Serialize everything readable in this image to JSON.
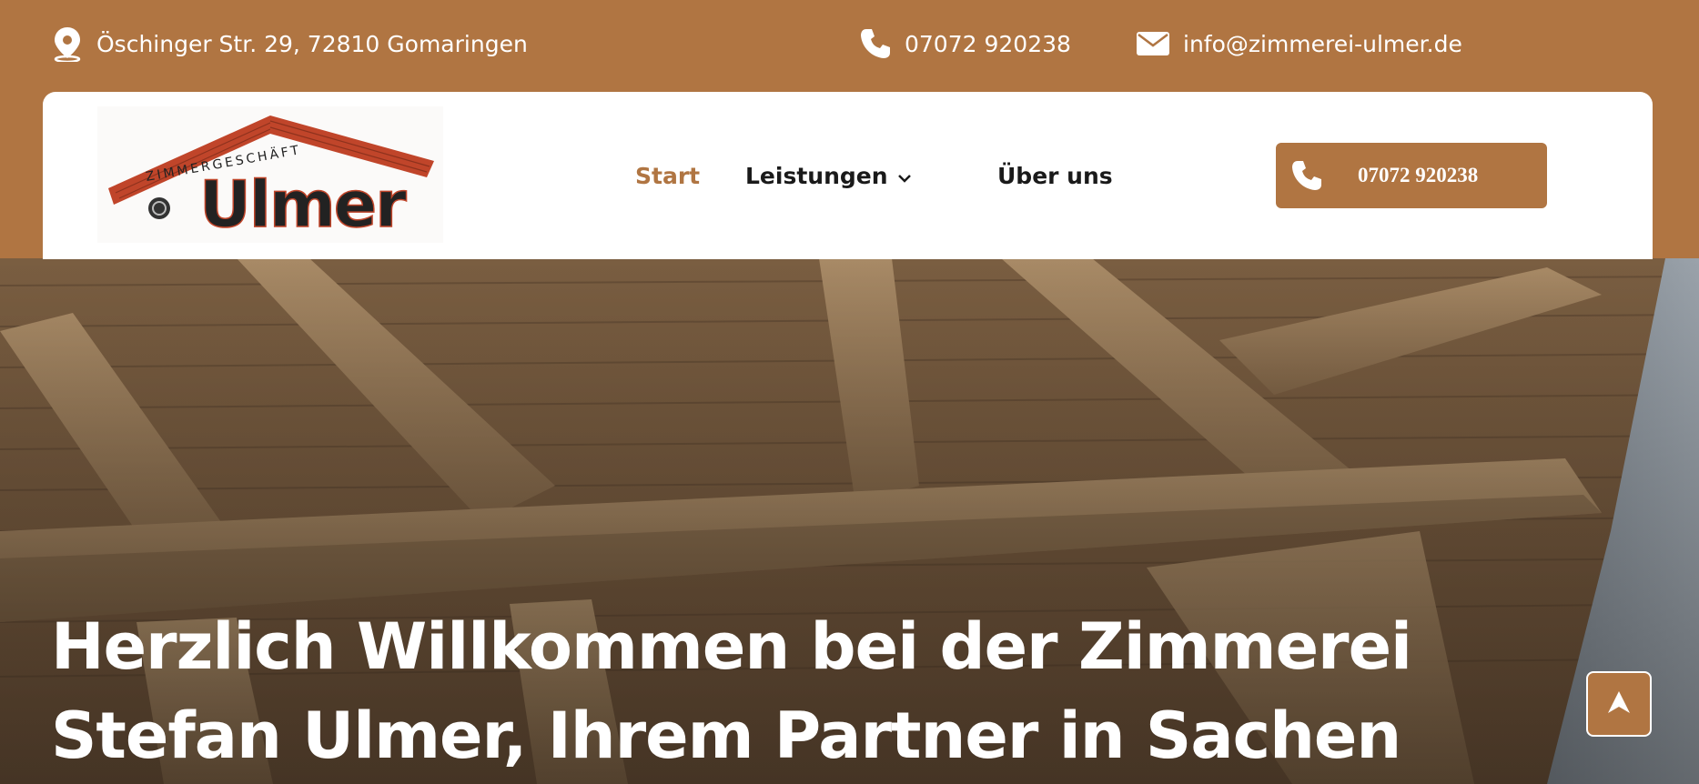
{
  "topbar": {
    "address": "Öschinger Str. 29, 72810 Gomaringen",
    "phone": "07072 920238",
    "email": "info@zimmerei-ulmer.de",
    "icons": [
      "map-pin-icon",
      "phone-icon",
      "envelope-icon"
    ]
  },
  "header": {
    "logo": {
      "tagline": "ZIMMERGESCHÄFT",
      "name": "Ulmer"
    },
    "nav": [
      {
        "label": "Start",
        "active": true
      },
      {
        "label": "Leistungen",
        "has_dropdown": true
      },
      {
        "label": "Über uns"
      }
    ],
    "call_button": {
      "label": "07072 920238",
      "icon": "phone-icon"
    }
  },
  "hero": {
    "title_line1": "Herzlich Willkommen bei der Zimmerei",
    "title_line2": "Stefan Ulmer, Ihrem Partner in Sachen"
  },
  "scroll_top": {
    "icon": "arrow-up-icon"
  },
  "colors": {
    "brand": "#b07542",
    "active_nav": "#b07542",
    "text_dark": "#1a1a1a",
    "white": "#ffffff"
  }
}
